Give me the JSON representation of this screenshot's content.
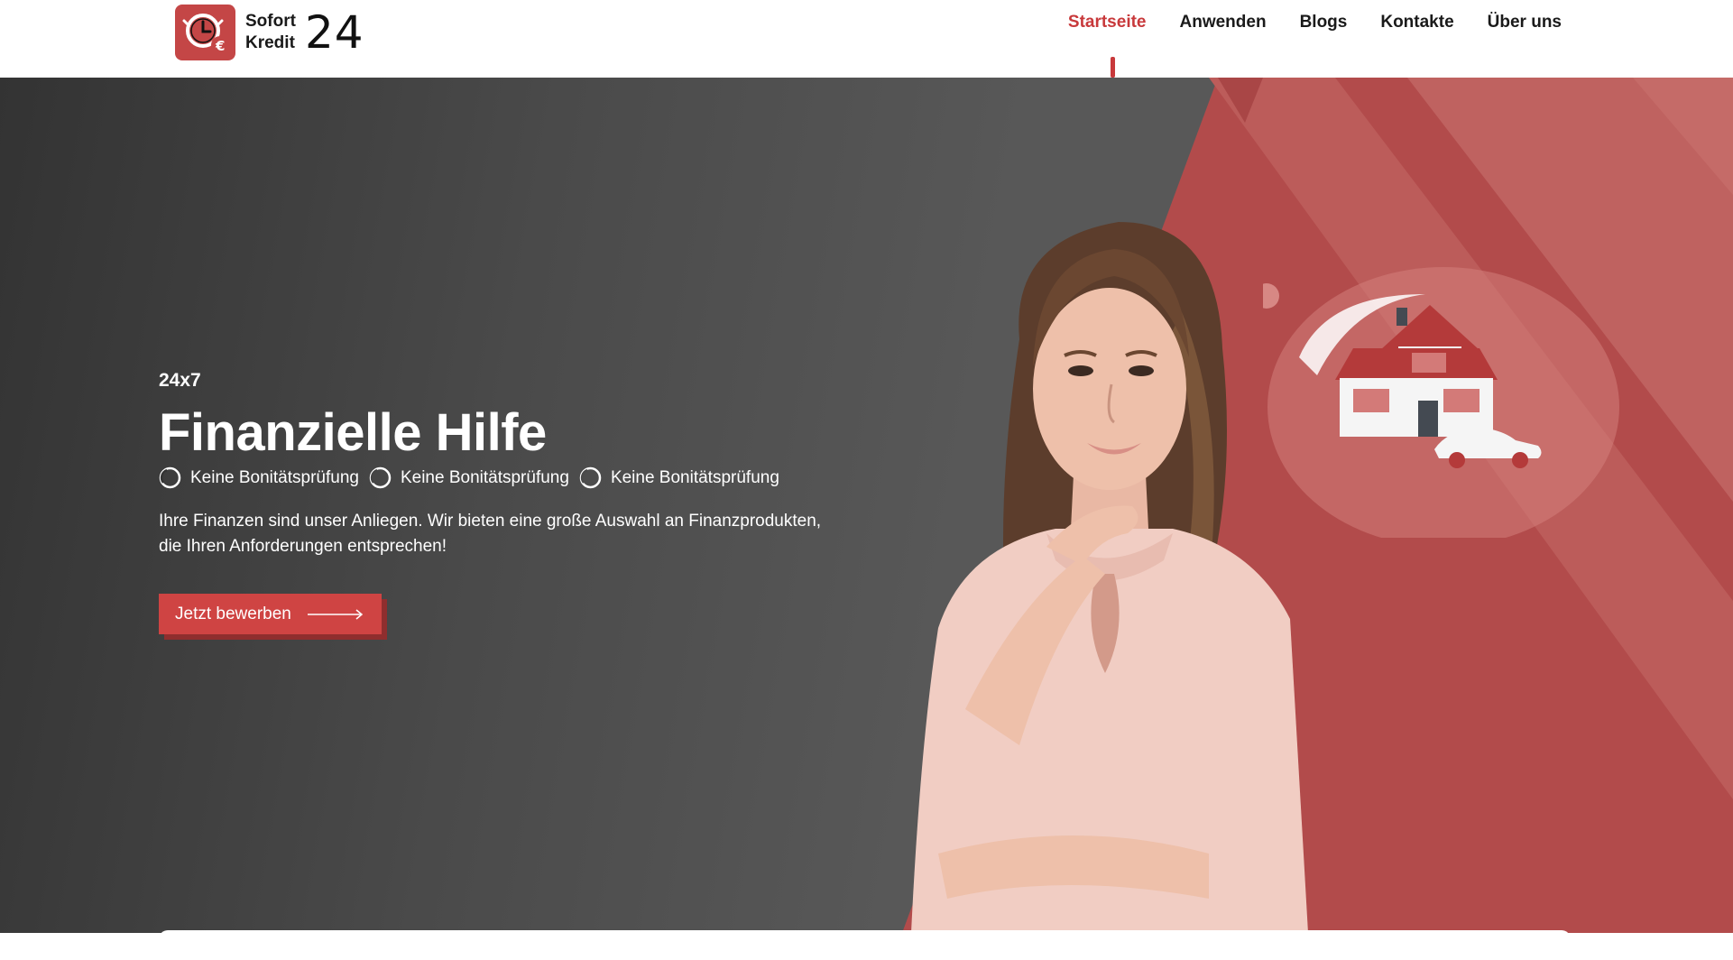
{
  "brand": {
    "word1": "Sofort",
    "word2": "Kredit",
    "number": "24",
    "accent_color": "#c8393b"
  },
  "nav": {
    "items": [
      {
        "label": "Startseite",
        "active": true
      },
      {
        "label": "Anwenden",
        "active": false
      },
      {
        "label": "Blogs",
        "active": false
      },
      {
        "label": "Kontakte",
        "active": false
      },
      {
        "label": "Über uns",
        "active": false
      }
    ]
  },
  "hero": {
    "eyebrow": "24x7",
    "title": "Finanzielle Hilfe",
    "features": [
      "Keine Bonitätsprüfung",
      "Keine Bonitätsprüfung",
      "Keine Bonitätsprüfung"
    ],
    "description": "Ihre Finanzen sind unser Anliegen. Wir bieten eine große Auswahl an Finanzprodukten, die Ihren Anforderungen entsprechen!",
    "cta_label": "Jetzt bewerben"
  },
  "icons": {
    "logo": "clock-euro-icon",
    "feature": "circle-check-icon",
    "cta": "arrow-right-icon"
  }
}
